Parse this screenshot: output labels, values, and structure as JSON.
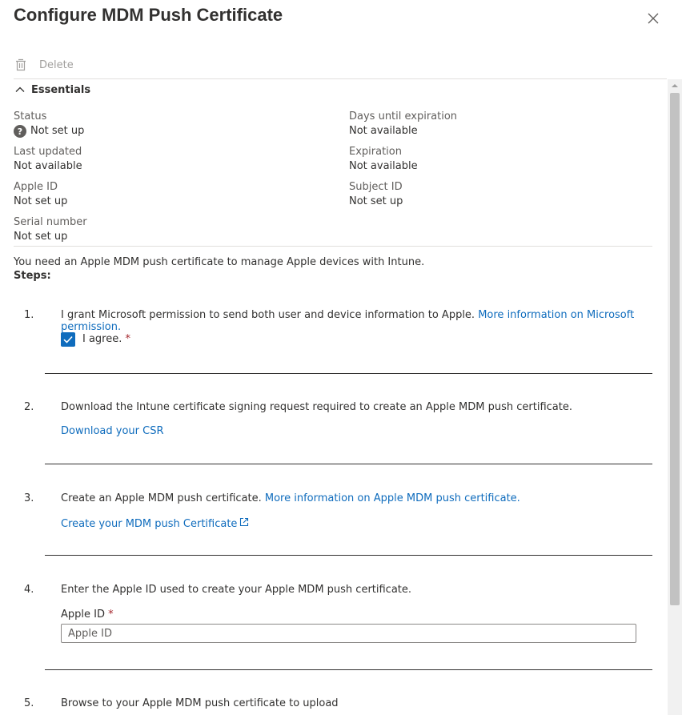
{
  "header": {
    "title": "Configure MDM Push Certificate"
  },
  "toolbar": {
    "delete_label": "Delete",
    "delete_icon": "trash-icon"
  },
  "essentials": {
    "label": "Essentials",
    "status_label": "Status",
    "status_value": "Not set up",
    "last_updated_label": "Last updated",
    "last_updated_value": "Not available",
    "apple_id_label": "Apple ID",
    "apple_id_value": "Not set up",
    "serial_label": "Serial number",
    "serial_value": "Not set up",
    "days_label": "Days until expiration",
    "days_value": "Not available",
    "expiration_label": "Expiration",
    "expiration_value": "Not available",
    "subject_label": "Subject ID",
    "subject_value": "Not set up"
  },
  "intro": {
    "text": "You need an Apple MDM push certificate to manage Apple devices with Intune.",
    "steps_heading": "Steps:"
  },
  "steps": [
    {
      "number": "1.",
      "text": "I grant Microsoft permission to send both user and device information to Apple.",
      "link": "More information on Microsoft permission."
    },
    {
      "number": "2.",
      "text": "Download the Intune certificate signing request required to create an Apple MDM push certificate.",
      "link": "Download your CSR"
    },
    {
      "number": "3.",
      "text": "Create an Apple MDM push certificate.",
      "link": "More information on Apple MDM push certificate.",
      "link2": "Create your MDM push Certificate"
    },
    {
      "number": "4.",
      "text": "Enter the Apple ID used to create your Apple MDM push certificate."
    },
    {
      "number": "5.",
      "text": "Browse to your Apple MDM push certificate to upload"
    }
  ],
  "agree": {
    "label": "I agree.",
    "required": "*",
    "checked": true
  },
  "apple_id_field": {
    "label": "Apple ID",
    "required": "*",
    "placeholder": "Apple ID",
    "value": ""
  },
  "colors": {
    "accent": "#0f6cbd",
    "required": "#a4262c",
    "text": "#323130"
  }
}
